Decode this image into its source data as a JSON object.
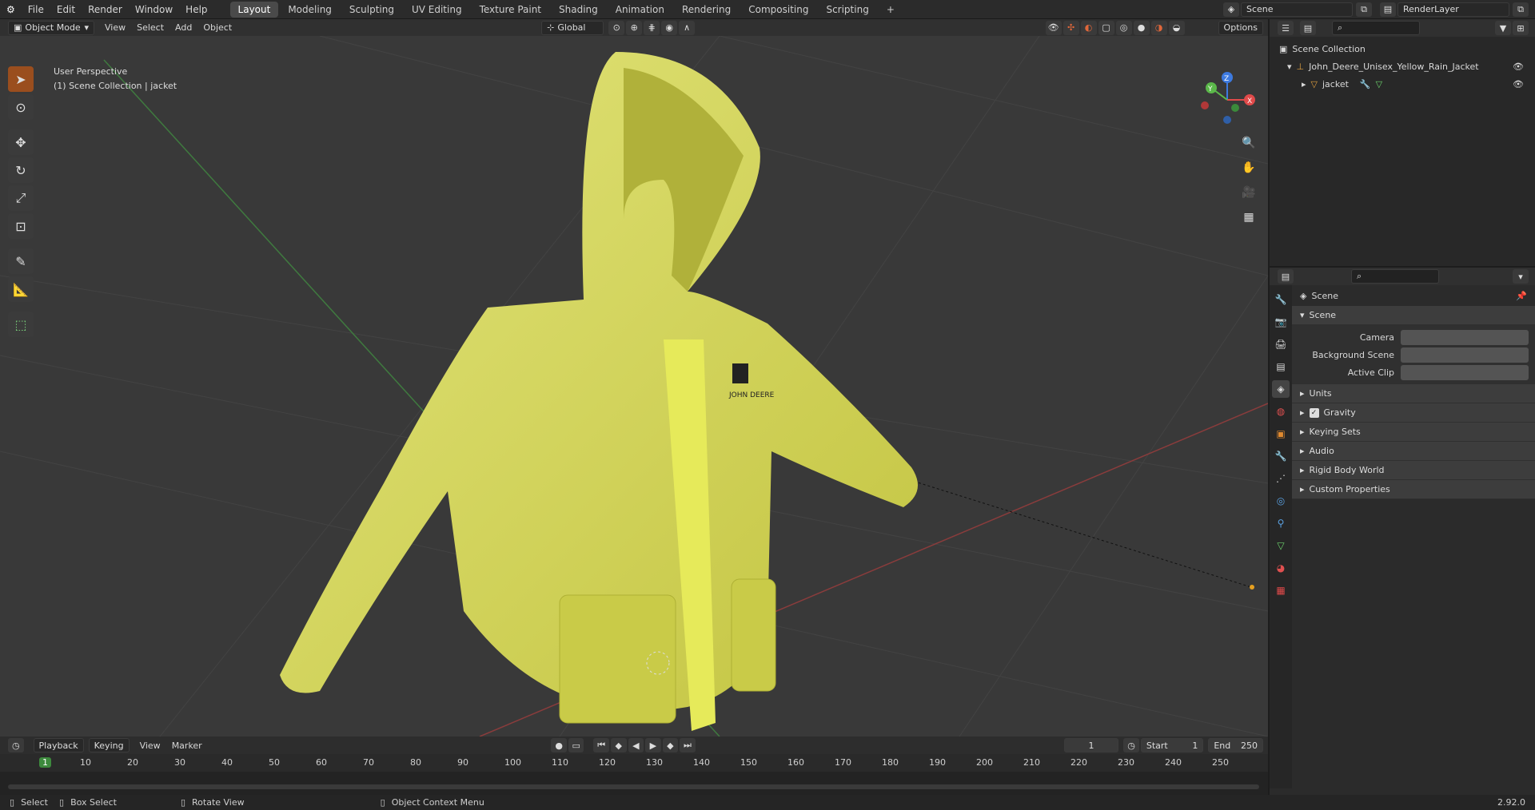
{
  "topbar": {
    "menus": [
      "File",
      "Edit",
      "Render",
      "Window",
      "Help"
    ],
    "workspaces": [
      "Layout",
      "Modeling",
      "Sculpting",
      "UV Editing",
      "Texture Paint",
      "Shading",
      "Animation",
      "Rendering",
      "Compositing",
      "Scripting"
    ],
    "add_label": "+",
    "scene": "Scene",
    "render_layer": "RenderLayer"
  },
  "viewport_header": {
    "mode": "Object Mode",
    "menus": [
      "View",
      "Select",
      "Add",
      "Object"
    ],
    "orientation": "Global",
    "options": "Options"
  },
  "viewport": {
    "perspective": "User Perspective",
    "collection": "(1) Scene Collection | jacket",
    "logo_line1": "JOHN DEERE",
    "gizmo": {
      "z": "Z",
      "y": "Y",
      "x": "X"
    }
  },
  "outliner": {
    "root": "Scene Collection",
    "items": [
      {
        "label": "John_Deere_Unisex_Yellow_Rain_Jacket"
      },
      {
        "label": "jacket"
      }
    ]
  },
  "properties": {
    "title": "Scene",
    "panel": "Scene",
    "fields": [
      {
        "label": "Camera"
      },
      {
        "label": "Background Scene"
      },
      {
        "label": "Active Clip"
      }
    ],
    "sections": [
      {
        "label": "Units"
      },
      {
        "label": "Gravity"
      },
      {
        "label": "Keying Sets"
      },
      {
        "label": "Audio"
      },
      {
        "label": "Rigid Body World"
      },
      {
        "label": "Custom Properties"
      }
    ]
  },
  "timeline": {
    "menus": [
      "Playback",
      "Keying",
      "View",
      "Marker"
    ],
    "current_frame": "1",
    "start_label": "Start",
    "start": "1",
    "end_label": "End",
    "end": "250",
    "ticks": [
      "1",
      "10",
      "20",
      "30",
      "40",
      "50",
      "60",
      "70",
      "80",
      "90",
      "100",
      "110",
      "120",
      "130",
      "140",
      "150",
      "160",
      "170",
      "180",
      "190",
      "200",
      "210",
      "220",
      "230",
      "240",
      "250"
    ]
  },
  "status": {
    "select": "Select",
    "box_select": "Box Select",
    "rotate": "Rotate View",
    "context": "Object Context Menu",
    "version": "2.92.0"
  }
}
